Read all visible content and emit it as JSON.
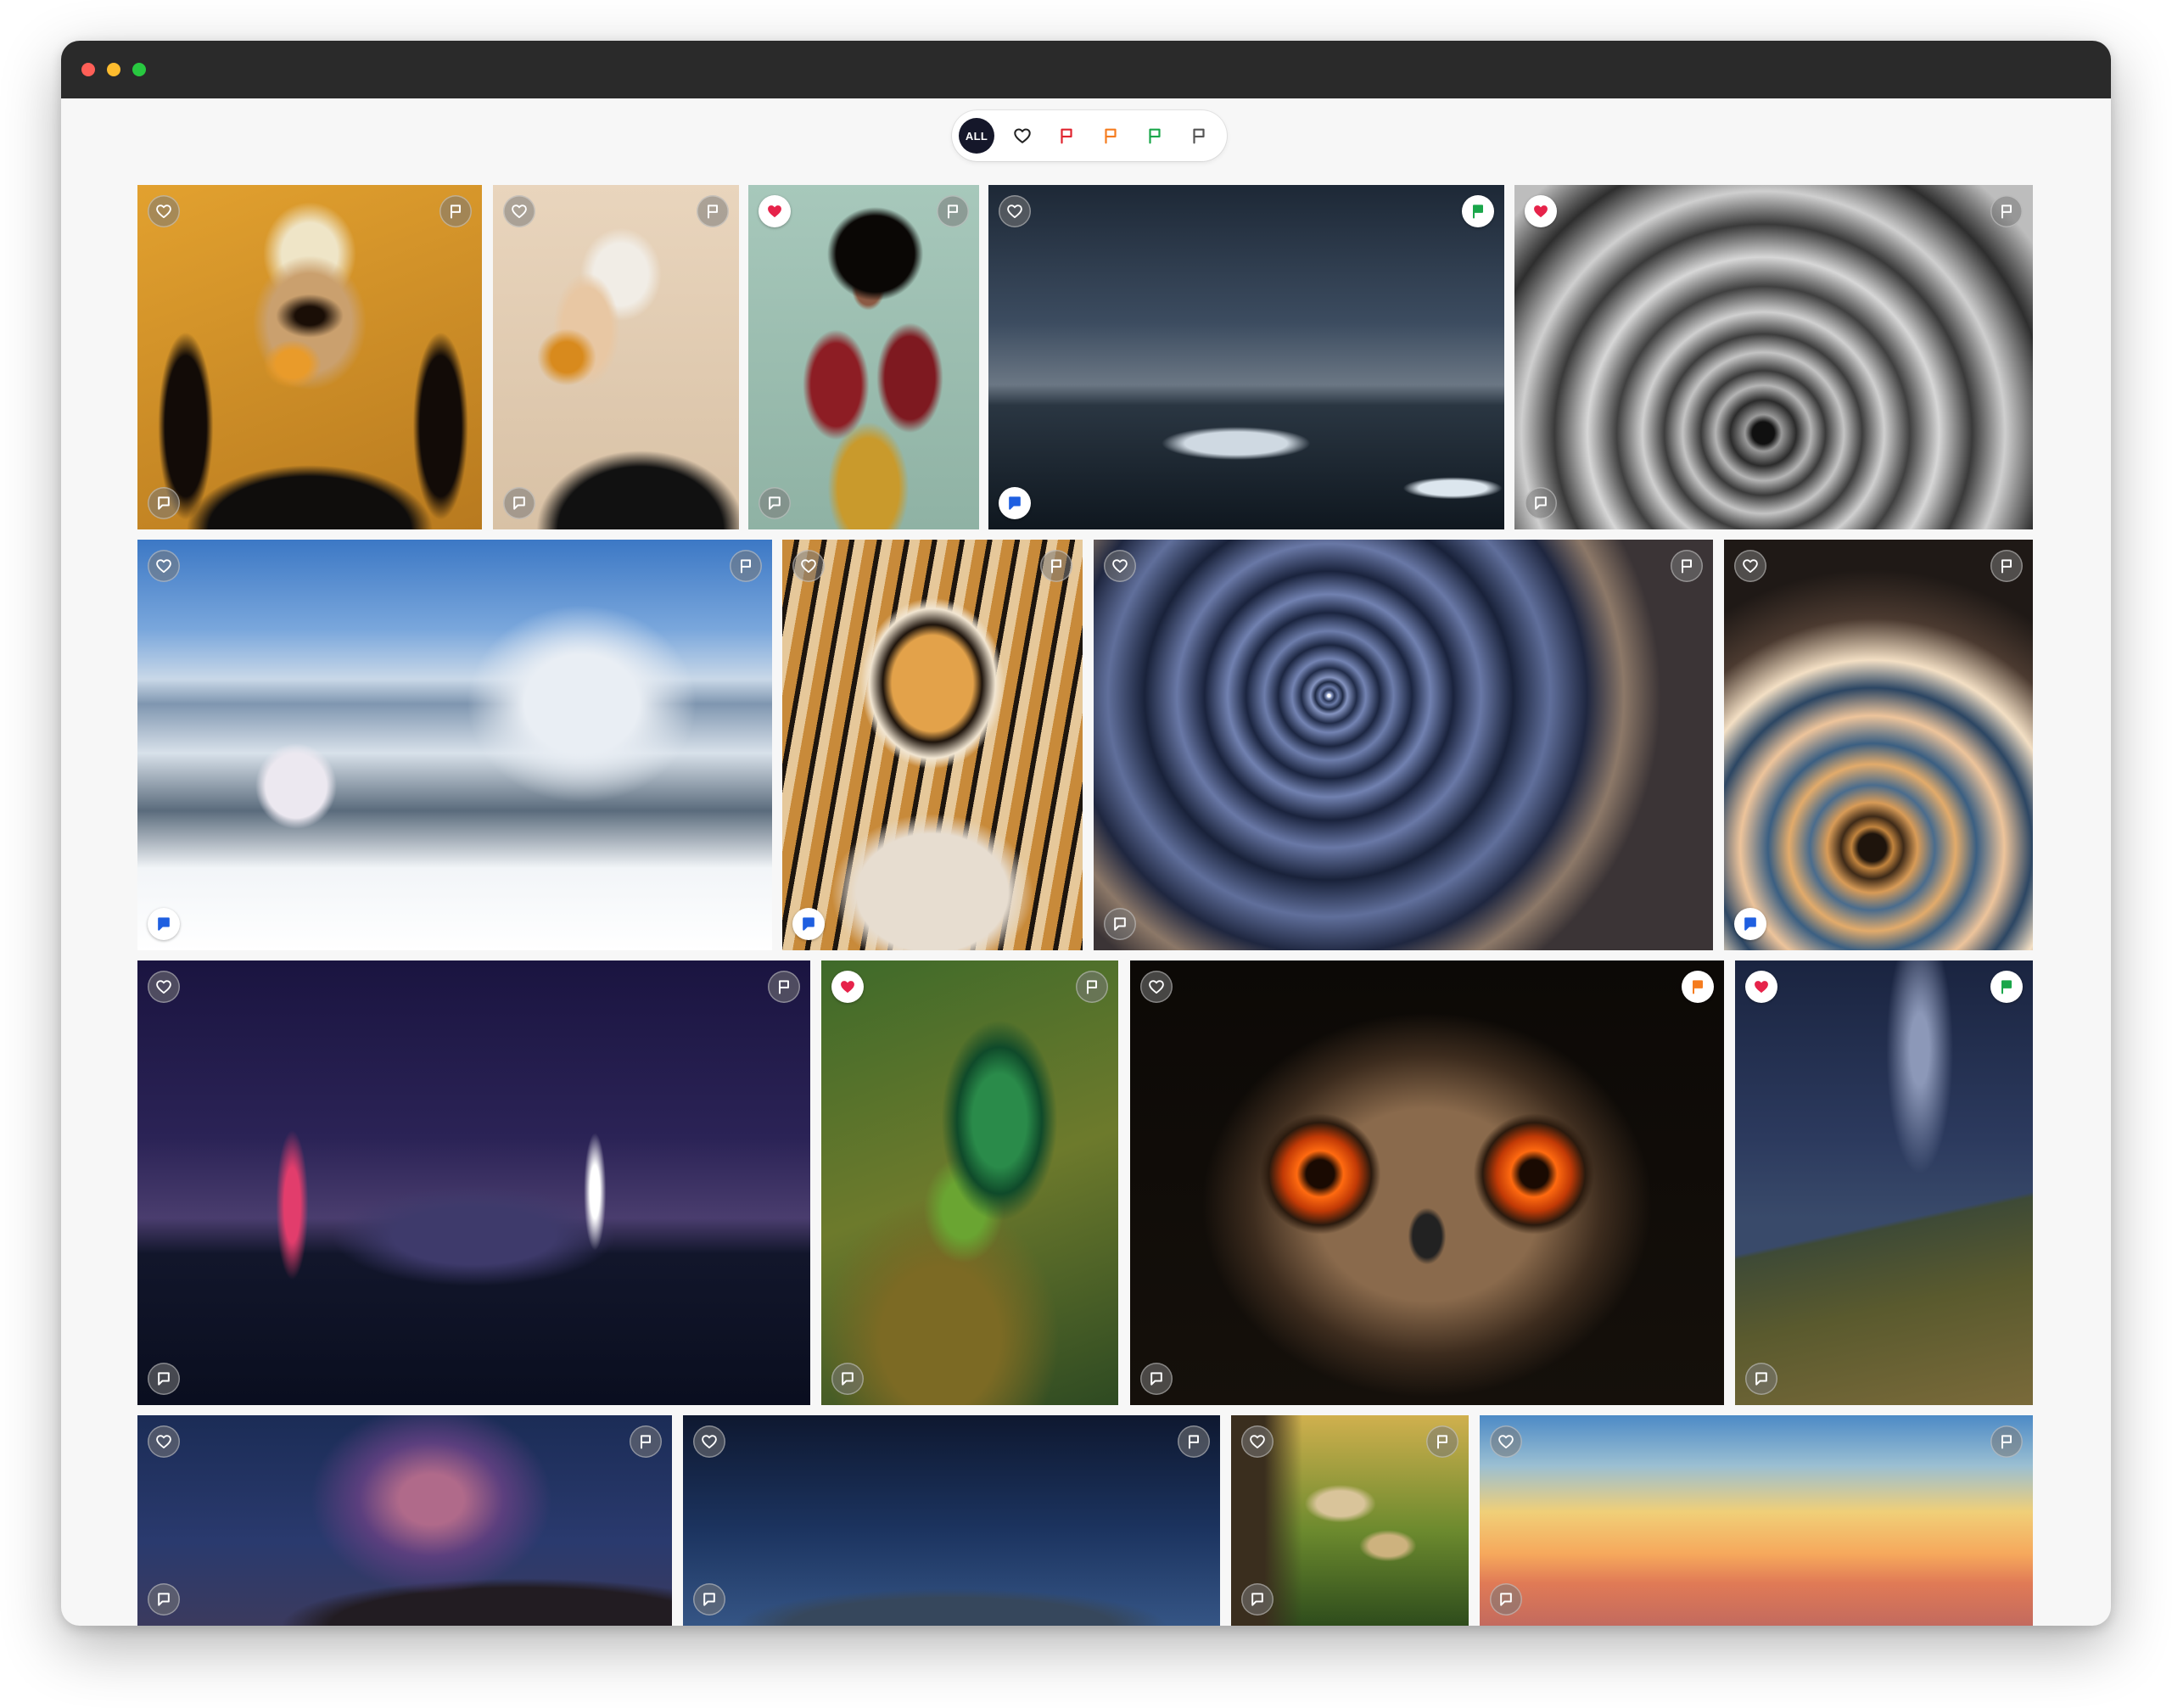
{
  "filters": {
    "items": [
      {
        "key": "all",
        "label": "ALL",
        "icon": "all-text",
        "active": true
      },
      {
        "key": "liked",
        "icon": "heart-outline-icon",
        "color": "#222222"
      },
      {
        "key": "red",
        "icon": "flag-icon",
        "color": "#e0242f"
      },
      {
        "key": "orange",
        "icon": "flag-icon",
        "color": "#f57c1f"
      },
      {
        "key": "green",
        "icon": "flag-icon",
        "color": "#1aa64a"
      },
      {
        "key": "none",
        "icon": "flag-icon",
        "color": "#555555"
      }
    ]
  },
  "colors": {
    "heart": "#e6234a",
    "red_flag": "#e0242f",
    "orange_flag": "#f57c1f",
    "green_flag": "#1aa64a",
    "blue_note": "#1f5fe0",
    "filter_active": "#15172a"
  },
  "photos": [
    {
      "id": "butterfly-portrait-gold",
      "liked": false,
      "flag": "none",
      "note": "none"
    },
    {
      "id": "butterfly-portrait-beige",
      "liked": false,
      "flag": "none",
      "note": "none"
    },
    {
      "id": "afro-woman-red-jacket",
      "liked": true,
      "flag": "none",
      "note": "none"
    },
    {
      "id": "glacier-lagoon-night",
      "liked": false,
      "flag": "green",
      "note": "blue"
    },
    {
      "id": "spiral-staircase-bw",
      "liked": true,
      "flag": "none",
      "note": "none"
    },
    {
      "id": "alpine-church-winter",
      "liked": false,
      "flag": "none",
      "note": "blue"
    },
    {
      "id": "tiger",
      "liked": false,
      "flag": "none",
      "note": "blue"
    },
    {
      "id": "star-trails",
      "liked": false,
      "flag": "none",
      "note": "none"
    },
    {
      "id": "spiral-staircase-blue",
      "liked": false,
      "flag": "none",
      "note": "blue"
    },
    {
      "id": "shanghai-skyline-night",
      "liked": false,
      "flag": "none",
      "note": "none"
    },
    {
      "id": "green-beetle",
      "liked": true,
      "flag": "none",
      "note": "none"
    },
    {
      "id": "owl-orange-eyes",
      "liked": false,
      "flag": "orange",
      "note": "none"
    },
    {
      "id": "milky-way-mountains",
      "liked": true,
      "flag": "green",
      "note": "none"
    },
    {
      "id": "milky-way-ridge",
      "liked": false,
      "flag": "none",
      "note": "none"
    },
    {
      "id": "dead-tree-night",
      "liked": false,
      "flag": "none",
      "note": "none"
    },
    {
      "id": "mushrooms",
      "liked": false,
      "flag": "none",
      "note": "none"
    },
    {
      "id": "sunset-mountains",
      "liked": false,
      "flag": "none",
      "note": "none"
    }
  ]
}
